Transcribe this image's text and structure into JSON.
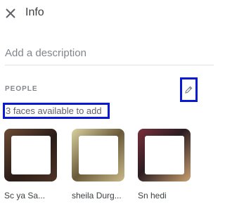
{
  "header": {
    "title": "Info",
    "close_icon": "close-icon"
  },
  "description": {
    "placeholder": "Add a description"
  },
  "people": {
    "section_title": "PEOPLE",
    "edit_icon": "pencil-icon",
    "faces_available": "3 faces available to add",
    "faces": [
      {
        "name": "Sc    ya Sa...",
        "color": "#3a2a22"
      },
      {
        "name": "sheila Durg...",
        "color": "#6b5a3a"
      },
      {
        "name": "        Sn hedi",
        "color": "#4a2c30"
      }
    ]
  },
  "colors": {
    "highlight": "#0a1ad2",
    "text": "#3c4043",
    "muted": "#80868b"
  }
}
